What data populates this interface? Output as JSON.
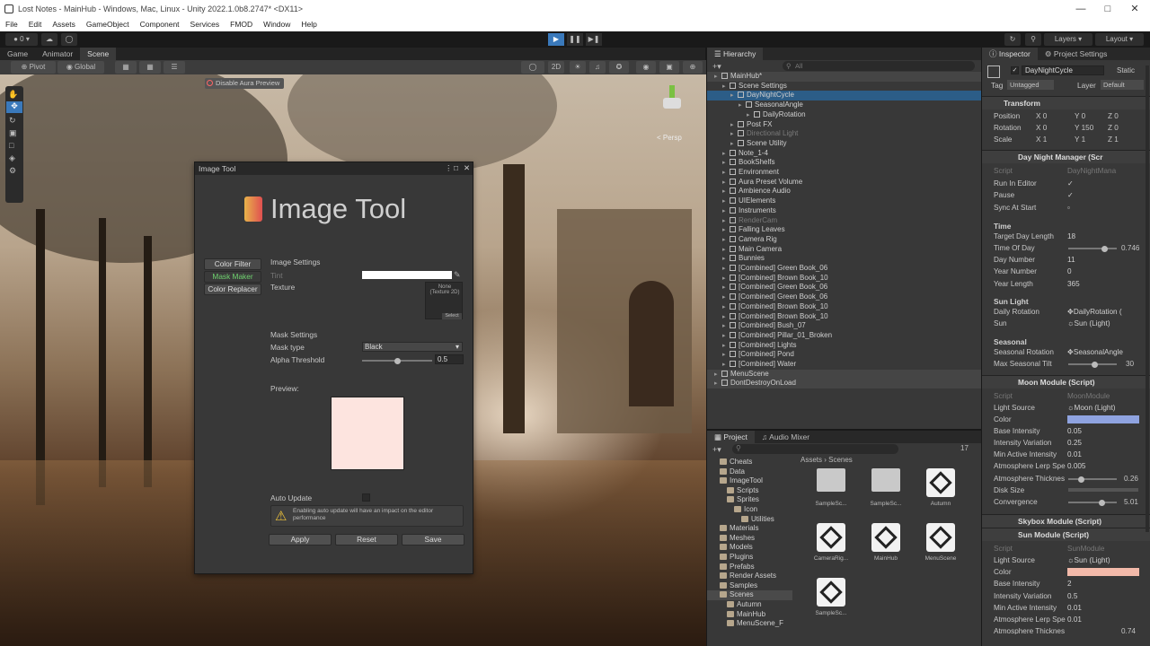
{
  "window": {
    "title": "Lost Notes - MainHub - Windows, Mac, Linux - Unity 2022.1.0b8.2747* <DX11>"
  },
  "menu": [
    "File",
    "Edit",
    "Assets",
    "GameObject",
    "Component",
    "Services",
    "FMOD",
    "Window",
    "Help"
  ],
  "toolbar": {
    "counter": "0",
    "layers_label": "Layers",
    "layout_label": "Layout"
  },
  "scene_tabs": [
    "Game",
    "Animator",
    "Scene"
  ],
  "scene_tools": {
    "pivot": "Pivot",
    "global": "Global",
    "mode_2d": "2D"
  },
  "scene": {
    "aura_button": "Disable Aura Preview",
    "gizmo_label": "< Persp"
  },
  "image_tool": {
    "window_title": "Image Tool",
    "header_title": "Image Tool",
    "modes": [
      "Color Filter",
      "Mask Maker",
      "Color Replacer"
    ],
    "image_settings": {
      "title": "Image Settings",
      "tint_label": "Tint",
      "texture_label": "Texture",
      "texture_value": "None\n(Texture 2D)",
      "select_label": "Select"
    },
    "mask_settings": {
      "title": "Mask Settings",
      "mask_type_label": "Mask type",
      "mask_type_value": "Black",
      "alpha_label": "Alpha Threshold",
      "alpha_value": "0.5",
      "alpha_fraction": 0.5
    },
    "preview_label": "Preview:",
    "auto_update_label": "Auto Update",
    "warning": "Enabling auto update will have an impact on the editor performance",
    "buttons": {
      "apply": "Apply",
      "reset": "Reset",
      "save": "Save"
    }
  },
  "hierarchy": {
    "tab": "Hierarchy",
    "search_placeholder": "All",
    "rows": [
      {
        "name": "MainHub*",
        "depth": 0,
        "dim": false
      },
      {
        "name": "Scene Settings",
        "depth": 1,
        "dim": false
      },
      {
        "name": "DayNightCycle",
        "depth": 2,
        "dim": false
      },
      {
        "name": "SeasonalAngle",
        "depth": 3,
        "dim": false
      },
      {
        "name": "DailyRotation",
        "depth": 4,
        "dim": false
      },
      {
        "name": "Post FX",
        "depth": 2,
        "dim": false
      },
      {
        "name": "Directional Light",
        "depth": 2,
        "dim": true
      },
      {
        "name": "Scene Utility",
        "depth": 2,
        "dim": false
      },
      {
        "name": "Note_1-4",
        "depth": 1,
        "dim": false
      },
      {
        "name": "BookShelfs",
        "depth": 1,
        "dim": false
      },
      {
        "name": "Environment",
        "depth": 1,
        "dim": false
      },
      {
        "name": "Aura Preset Volume",
        "depth": 1,
        "dim": false
      },
      {
        "name": "Ambience Audio",
        "depth": 1,
        "dim": false
      },
      {
        "name": "UIElements",
        "depth": 1,
        "dim": false
      },
      {
        "name": "Instruments",
        "depth": 1,
        "dim": false
      },
      {
        "name": "RenderCam",
        "depth": 1,
        "dim": true
      },
      {
        "name": "Falling Leaves",
        "depth": 1,
        "dim": false
      },
      {
        "name": "Camera Rig",
        "depth": 1,
        "dim": false
      },
      {
        "name": "Main Camera",
        "depth": 1,
        "dim": false
      },
      {
        "name": "Bunnies",
        "depth": 1,
        "dim": false
      },
      {
        "name": "[Combined] Green Book_06",
        "depth": 1,
        "dim": false
      },
      {
        "name": "[Combined] Brown Book_10",
        "depth": 1,
        "dim": false
      },
      {
        "name": "[Combined] Green Book_06",
        "depth": 1,
        "dim": false
      },
      {
        "name": "[Combined] Green Book_06",
        "depth": 1,
        "dim": false
      },
      {
        "name": "[Combined] Brown Book_10",
        "depth": 1,
        "dim": false
      },
      {
        "name": "[Combined] Brown Book_10",
        "depth": 1,
        "dim": false
      },
      {
        "name": "[Combined] Bush_07",
        "depth": 1,
        "dim": false
      },
      {
        "name": "[Combined] Pillar_01_Broken",
        "depth": 1,
        "dim": false
      },
      {
        "name": "[Combined] Lights",
        "depth": 1,
        "dim": false
      },
      {
        "name": "[Combined] Pond",
        "depth": 1,
        "dim": false
      },
      {
        "name": "[Combined] Water",
        "depth": 1,
        "dim": false
      },
      {
        "name": "MenuScene",
        "depth": 0,
        "dim": false
      },
      {
        "name": "DontDestroyOnLoad",
        "depth": 0,
        "dim": false
      }
    ]
  },
  "project": {
    "tabs": [
      "Project",
      "Audio Mixer"
    ],
    "breadcrumb": [
      "Assets",
      "Scenes"
    ],
    "count": "17",
    "tree": [
      {
        "name": "Cheats",
        "depth": 1
      },
      {
        "name": "Data",
        "depth": 1
      },
      {
        "name": "ImageTool",
        "depth": 1
      },
      {
        "name": "Scripts",
        "depth": 2
      },
      {
        "name": "Sprites",
        "depth": 2
      },
      {
        "name": "Icon",
        "depth": 3
      },
      {
        "name": "Utilities",
        "depth": 4
      },
      {
        "name": "Materials",
        "depth": 1
      },
      {
        "name": "Meshes",
        "depth": 1
      },
      {
        "name": "Models",
        "depth": 1
      },
      {
        "name": "Plugins",
        "depth": 1
      },
      {
        "name": "Prefabs",
        "depth": 1
      },
      {
        "name": "Render Assets",
        "depth": 1
      },
      {
        "name": "Samples",
        "depth": 1
      },
      {
        "name": "Scenes",
        "depth": 1
      },
      {
        "name": "Autumn",
        "depth": 2
      },
      {
        "name": "MainHub",
        "depth": 2
      },
      {
        "name": "MenuScene_F",
        "depth": 2
      }
    ],
    "assets": [
      {
        "name": "SampleSc...",
        "kind": "folder"
      },
      {
        "name": "SampleSc...",
        "kind": "folder"
      },
      {
        "name": "Autumn",
        "kind": "scene"
      },
      {
        "name": "CameraRig...",
        "kind": "scene"
      },
      {
        "name": "MainHub",
        "kind": "scene"
      },
      {
        "name": "MenuScene",
        "kind": "scene"
      },
      {
        "name": "SampleSc...",
        "kind": "scene"
      }
    ]
  },
  "inspector": {
    "tabs": [
      "Inspector",
      "Project Settings"
    ],
    "object_name": "DayNightCycle",
    "static_label": "Static",
    "tag_label": "Tag",
    "tag_value": "Untagged",
    "layer_label": "Layer",
    "layer_value": "Default",
    "transform": {
      "title": "Transform",
      "position": {
        "label": "Position",
        "x": "0",
        "y": "0",
        "z": "0"
      },
      "rotation": {
        "label": "Rotation",
        "x": "0",
        "y": "150",
        "z": "0"
      },
      "scale": {
        "label": "Scale",
        "x": "1",
        "y": "1",
        "z": "1"
      }
    },
    "day_night": {
      "title": "Day Night Manager (Scr",
      "script_label": "Script",
      "script_value": "DayNightMana",
      "run_in_editor": "Run In Editor",
      "pause": "Pause",
      "sync": "Sync At Start",
      "time_header": "Time",
      "target_day_length": {
        "label": "Target Day Length",
        "value": "18"
      },
      "time_of_day": {
        "label": "Time Of Day",
        "value": "0.746",
        "fraction": 0.746
      },
      "day_number": {
        "label": "Day Number",
        "value": "11"
      },
      "year_number": {
        "label": "Year Number",
        "value": "0"
      },
      "year_length": {
        "label": "Year Length",
        "value": "365"
      },
      "sun_light_header": "Sun Light",
      "daily_rotation": {
        "label": "Daily Rotation",
        "value": "DailyRotation ("
      },
      "sun": {
        "label": "Sun",
        "value": "Sun (Light)"
      },
      "seasonal_header": "Seasonal",
      "seasonal_rotation": {
        "label": "Seasonal Rotation",
        "value": "SeasonalAngle"
      },
      "max_tilt": {
        "label": "Max Seasonal Tilt",
        "value": "30",
        "fraction": 0.55
      }
    },
    "moon": {
      "title": "Moon Module (Script)",
      "script_label": "Script",
      "script_value": "MoonModule",
      "light_source": {
        "label": "Light Source",
        "value": "Moon (Light)"
      },
      "color": {
        "label": "Color",
        "hex": "#8fa3e0"
      },
      "base_intensity": {
        "label": "Base Intensity",
        "value": "0.05"
      },
      "intensity_variation": {
        "label": "Intensity Variation",
        "value": "0.25"
      },
      "min_active": {
        "label": "Min Active Intensity",
        "value": "0.01"
      },
      "atmos_lerp": {
        "label": "Atmosphere Lerp Spe",
        "value": "0.005"
      },
      "atmos_thick": {
        "label": "Atmosphere Thicknes",
        "value": "0.26",
        "fraction": 0.26
      },
      "disk_size": {
        "label": "Disk Size",
        "value": ""
      },
      "convergence": {
        "label": "Convergence",
        "value": "5.01",
        "fraction": 0.7
      }
    },
    "skybox": {
      "title": "Skybox Module (Script)"
    },
    "sun": {
      "title": "Sun Module (Script)",
      "script_label": "Script",
      "script_value": "SunModule",
      "light_source": {
        "label": "Light Source",
        "value": "Sun (Light)"
      },
      "color": {
        "label": "Color",
        "hex": "#f2b9a9"
      },
      "base_intensity": {
        "label": "Base Intensity",
        "value": "2"
      },
      "intensity_variation": {
        "label": "Intensity Variation",
        "value": "0.5"
      },
      "min_active": {
        "label": "Min Active Intensity",
        "value": "0.01"
      },
      "atmos_lerp": {
        "label": "Atmosphere Lerp Spe",
        "value": "0.01"
      },
      "atmos_thick": {
        "label": "Atmosphere Thicknes",
        "value": "0.74"
      }
    }
  },
  "colors": {
    "accent_blue": "#3a79bb",
    "play_blue": "#4a90ff",
    "mask_green": "#6fd36f",
    "preview_fill": "#fde4df"
  }
}
